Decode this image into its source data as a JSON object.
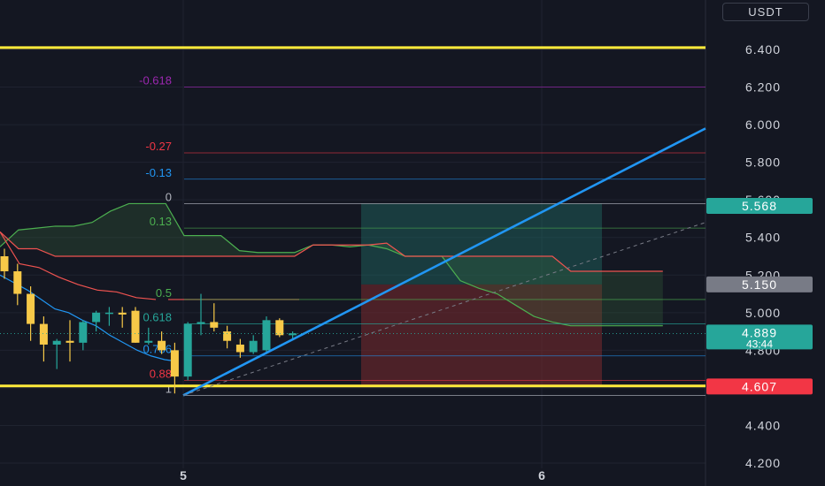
{
  "currency_button": "USDT",
  "colors": {
    "background": "#141722",
    "grid": "#1f2330",
    "candle_up": "#26a69a",
    "candle_down": "#f7c948",
    "support_resistance": "#ffeb3b",
    "trend_line": "#2196f3",
    "ichimoku_a": "#4caf50",
    "ichimoku_b": "#ef5350",
    "target_zone": "#1e6b63",
    "stop_zone": "#7a2a2e",
    "axis_text": "#d1d4dc"
  },
  "chart_data": {
    "type": "candlestick",
    "y_axis": {
      "ticks": [
        "6.400",
        "6.200",
        "6.000",
        "5.800",
        "5.600",
        "5.400",
        "5.200",
        "5.000",
        "4.800",
        "4.600",
        "4.400",
        "4.200"
      ],
      "range": [
        4.18,
        6.65
      ]
    },
    "x_axis": {
      "ticks": [
        "5",
        "6"
      ]
    },
    "price_labels": [
      {
        "text": "5.568",
        "value": 5.568,
        "color": "#26a69a"
      },
      {
        "text": "5.150",
        "value": 5.15,
        "color": "#787b86"
      },
      {
        "text": "4.889",
        "sub": "43:44",
        "value": 4.889,
        "color": "#26a69a"
      },
      {
        "text": "4.607",
        "value": 4.607,
        "color": "#f23645"
      }
    ],
    "horizontal_levels": [
      {
        "name": "resistance",
        "value": 6.41
      },
      {
        "name": "support",
        "value": 4.61
      }
    ],
    "fibonacci": {
      "color": "#787b86",
      "levels": [
        {
          "label": "-0.618",
          "value": 6.2,
          "color": "#9c27b0"
        },
        {
          "label": "-0.27",
          "value": 5.85,
          "color": "#f23645"
        },
        {
          "label": "-0.13",
          "value": 5.71,
          "color": "#2196f3"
        },
        {
          "label": "0",
          "value": 5.58,
          "color": "#b2b5be"
        },
        {
          "label": "0.13",
          "value": 5.45,
          "color": "#4caf50"
        },
        {
          "label": "0.5",
          "value": 5.07,
          "color": "#4caf50"
        },
        {
          "label": "0.618",
          "value": 4.94,
          "color": "#26a69a"
        },
        {
          "label": "0.786",
          "value": 4.77,
          "color": "#2196f3"
        },
        {
          "label": "0.88",
          "value": 4.64,
          "color": "#f23645"
        },
        {
          "label": "1",
          "value": 4.56,
          "color": "#b2b5be"
        }
      ]
    },
    "candles": [
      {
        "o": 5.3,
        "h": 5.34,
        "l": 5.18,
        "c": 5.22
      },
      {
        "o": 5.22,
        "h": 5.26,
        "l": 5.04,
        "c": 5.1
      },
      {
        "o": 5.1,
        "h": 5.14,
        "l": 4.85,
        "c": 4.94
      },
      {
        "o": 4.94,
        "h": 4.98,
        "l": 4.74,
        "c": 4.83
      },
      {
        "o": 4.83,
        "h": 4.86,
        "l": 4.7,
        "c": 4.85
      },
      {
        "o": 4.85,
        "h": 4.96,
        "l": 4.74,
        "c": 4.84
      },
      {
        "o": 4.84,
        "h": 4.96,
        "l": 4.8,
        "c": 4.95
      },
      {
        "o": 4.95,
        "h": 5.01,
        "l": 4.9,
        "c": 5.0
      },
      {
        "o": 5.0,
        "h": 5.03,
        "l": 4.93,
        "c": 5.0
      },
      {
        "o": 5.0,
        "h": 5.03,
        "l": 4.92,
        "c": 4.99
      },
      {
        "o": 5.01,
        "h": 5.03,
        "l": 4.84,
        "c": 4.84
      },
      {
        "o": 4.84,
        "h": 4.92,
        "l": 4.83,
        "c": 4.85
      },
      {
        "o": 4.85,
        "h": 4.9,
        "l": 4.78,
        "c": 4.8
      },
      {
        "o": 4.8,
        "h": 4.84,
        "l": 4.57,
        "c": 4.66
      },
      {
        "o": 4.66,
        "h": 4.95,
        "l": 4.64,
        "c": 4.94
      },
      {
        "o": 4.94,
        "h": 5.1,
        "l": 4.88,
        "c": 4.95
      },
      {
        "o": 4.95,
        "h": 5.05,
        "l": 4.9,
        "c": 4.92
      },
      {
        "o": 4.9,
        "h": 4.93,
        "l": 4.81,
        "c": 4.85
      },
      {
        "o": 4.83,
        "h": 4.86,
        "l": 4.76,
        "c": 4.79
      },
      {
        "o": 4.79,
        "h": 4.88,
        "l": 4.78,
        "c": 4.85
      },
      {
        "o": 4.8,
        "h": 4.98,
        "l": 4.78,
        "c": 4.96
      },
      {
        "o": 4.96,
        "h": 4.97,
        "l": 4.87,
        "c": 4.88
      },
      {
        "o": 4.88,
        "h": 4.9,
        "l": 4.86,
        "c": 4.89
      }
    ],
    "ichimoku_span_a": [
      5.35,
      5.44,
      5.45,
      5.46,
      5.46,
      5.48,
      5.54,
      5.58,
      5.58,
      5.58,
      5.41,
      5.41,
      5.41,
      5.33,
      5.32,
      5.32,
      5.32,
      5.36,
      5.36,
      5.35,
      5.36,
      5.34,
      5.3,
      5.3,
      5.3,
      5.17,
      5.13,
      5.1,
      5.04,
      4.98,
      4.95,
      4.93,
      4.93,
      4.93,
      4.93,
      4.93,
      4.93
    ],
    "ichimoku_span_b": [
      5.43,
      5.34,
      5.34,
      5.3,
      5.3,
      5.3,
      5.3,
      5.3,
      5.3,
      5.3,
      5.3,
      5.3,
      5.3,
      5.3,
      5.3,
      5.3,
      5.3,
      5.36,
      5.36,
      5.36,
      5.36,
      5.37,
      5.3,
      5.3,
      5.3,
      5.3,
      5.3,
      5.3,
      5.3,
      5.3,
      5.3,
      5.22,
      5.22,
      5.22,
      5.22,
      5.22,
      5.22
    ],
    "lagging_line": [
      5.43,
      5.26,
      5.24,
      5.19,
      5.15,
      5.12,
      5.11,
      5.08,
      5.07
    ],
    "conversion_line": [
      5.2,
      5.16,
      5.12,
      5.07,
      5.02,
      5.0,
      4.96,
      4.93,
      4.88,
      4.84,
      4.8,
      4.77,
      4.75,
      4.74
    ],
    "trend_line": {
      "from": [
        4.56
      ],
      "to": [
        5.98
      ]
    },
    "position": {
      "entry": 5.15,
      "target": 5.58,
      "stop": 4.61
    }
  }
}
